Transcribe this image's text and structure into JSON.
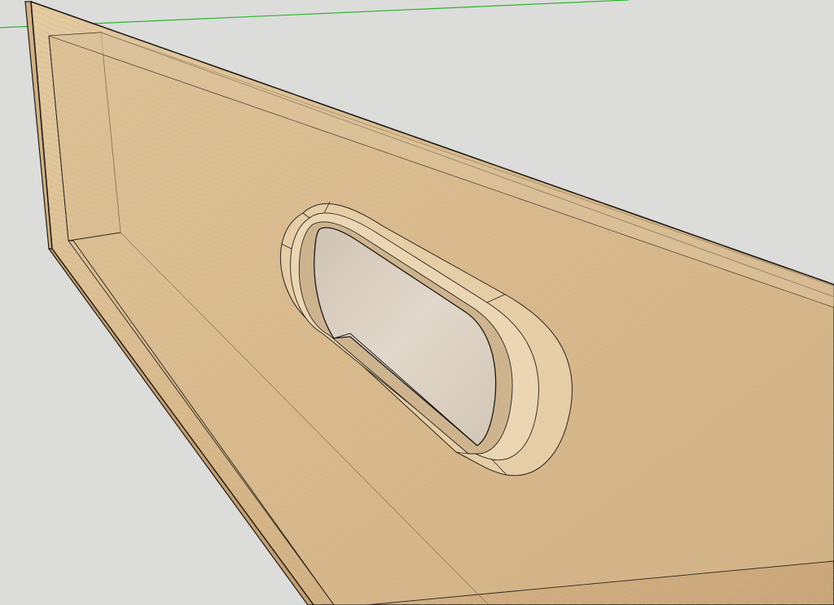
{
  "viewport": {
    "background_color": "#dcdcdb",
    "axis_color": "#2bb52b",
    "edge_color": "#1e1a16"
  },
  "model": {
    "material": "light-wood",
    "wood_light": "#e2c69a",
    "wood_mid": "#d4b386",
    "wood_dark": "#b9966b",
    "handle_cavity_color": "#ddd2c2"
  }
}
